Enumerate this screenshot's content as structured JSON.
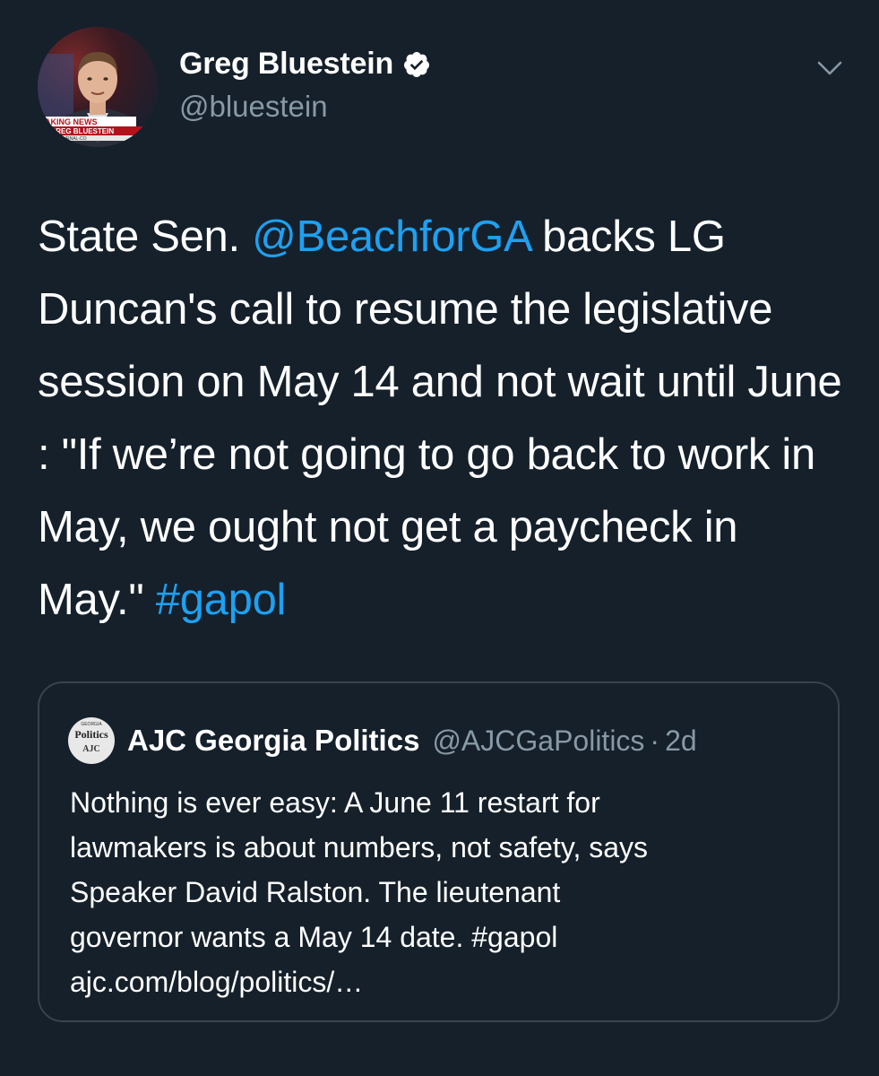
{
  "author": {
    "display_name": "Greg Bluestein",
    "handle": "@bluestein",
    "verified_icon": "verified-badge-icon",
    "avatar_banner": {
      "line1": "EAKING NEWS",
      "line2": "GREG BLUESTEIN",
      "line3": "JOURNAL-CO"
    }
  },
  "tweet": {
    "text_before_mention": "State Sen. ",
    "mention": "@BeachforGA",
    "text_after_mention": " backs LG Duncan's call to resume the legislative session on May 14 and not wait until June : \"If we’re not going to go back to work in May, we ought not get a paycheck in May.\" ",
    "hashtag": "#gapol"
  },
  "quote": {
    "avatar_lines": [
      "GEORGIA",
      "Politics",
      "AJC"
    ],
    "name": "AJC Georgia Politics",
    "handle": "@AJCGaPolitics",
    "separator": "·",
    "time": "2d",
    "lines": [
      "Nothing is ever easy: A June 11 restart for",
      "lawmakers is about numbers, not safety, says",
      "Speaker David Ralston. The lieutenant",
      "governor wants a May 14 date. #gapol",
      "ajc.com/blog/politics/…"
    ]
  },
  "colors": {
    "background": "#15202b",
    "link": "#1da1f2",
    "secondary_text": "#8899a6",
    "border": "#38444d",
    "verified_badge": "#ffffff"
  }
}
